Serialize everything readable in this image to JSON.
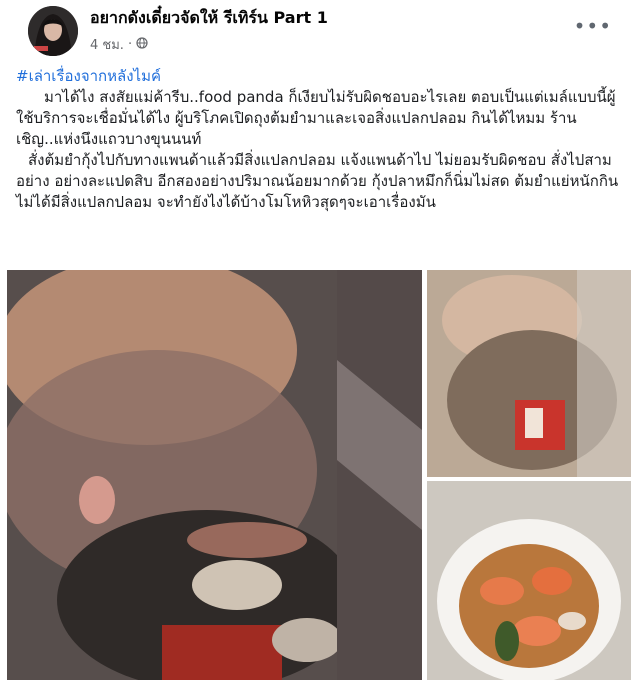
{
  "post": {
    "author": "อยากดังเดี๋ยวจัดให้ รีเทิร์น Part 1",
    "time": "4 ชม.",
    "hashtag": "#เล่าเรื่องจากหลังไมค์",
    "paragraphs": [
      "มาได้ไง สงสัยแม่ค้ารีบ..food panda ก็เงียบไม่รับผิดชอบอะไรเลย ตอบเป็นแต่เมล์แบบนี้ผู้ใช้บริการจะเชื่อมั่นได้ไง ผู้บริโภคเปิดถุงต้มยำมาและเจอสิ่งแปลกปลอม กินได้ไหมม ร้านเชิญ..แห่งนึงแถวบางขุนนนท์",
      "สั่งต้มยำกุ้งไปกับทางแพนด้าแล้วมีสิ่งแปลกปลอม แจ้งแพนด้าไป ไม่ยอมรับผิดชอบ สั่งไปสามอย่าง อย่างละแปดสิบ อีกสองอย่างปริมาณน้อยมากด้วย กุ้งปลาหมึกก็นิ่มไม่สด ต้มยำแย่หนักกินไม่ได้มีสิ่งแปลกปลอม จะทำยังไงได้บ้างโมโหหิวสุดๆจะเอาเรื่องมัน"
    ]
  },
  "colors": {
    "hashtag": "#216fdb",
    "text": "#1c1e21",
    "meta": "#65676b"
  },
  "icons": {
    "privacy": "globe-icon",
    "more": "more-options-icon"
  }
}
